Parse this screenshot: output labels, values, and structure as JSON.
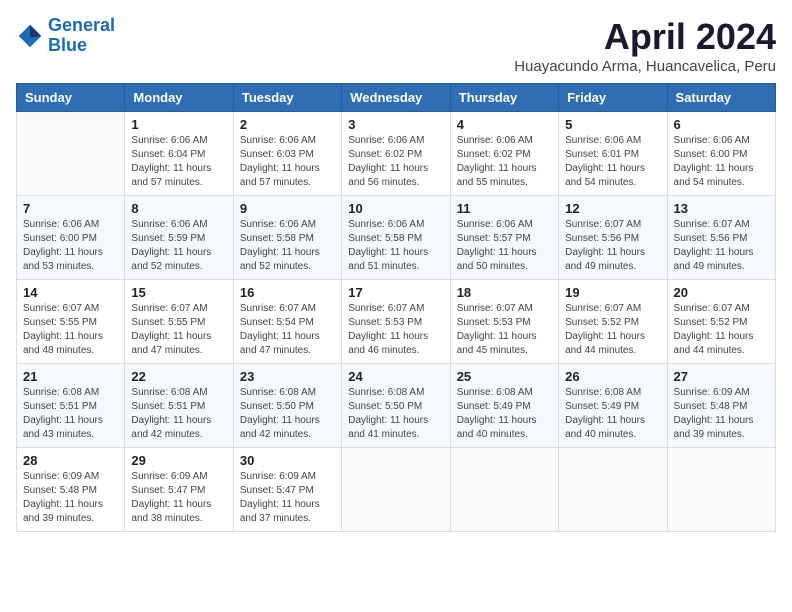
{
  "logo": {
    "line1": "General",
    "line2": "Blue"
  },
  "title": "April 2024",
  "subtitle": "Huayacundo Arma, Huancavelica, Peru",
  "days_of_week": [
    "Sunday",
    "Monday",
    "Tuesday",
    "Wednesday",
    "Thursday",
    "Friday",
    "Saturday"
  ],
  "weeks": [
    [
      {
        "day": "",
        "info": ""
      },
      {
        "day": "1",
        "info": "Sunrise: 6:06 AM\nSunset: 6:04 PM\nDaylight: 11 hours\nand 57 minutes."
      },
      {
        "day": "2",
        "info": "Sunrise: 6:06 AM\nSunset: 6:03 PM\nDaylight: 11 hours\nand 57 minutes."
      },
      {
        "day": "3",
        "info": "Sunrise: 6:06 AM\nSunset: 6:02 PM\nDaylight: 11 hours\nand 56 minutes."
      },
      {
        "day": "4",
        "info": "Sunrise: 6:06 AM\nSunset: 6:02 PM\nDaylight: 11 hours\nand 55 minutes."
      },
      {
        "day": "5",
        "info": "Sunrise: 6:06 AM\nSunset: 6:01 PM\nDaylight: 11 hours\nand 54 minutes."
      },
      {
        "day": "6",
        "info": "Sunrise: 6:06 AM\nSunset: 6:00 PM\nDaylight: 11 hours\nand 54 minutes."
      }
    ],
    [
      {
        "day": "7",
        "info": "Sunrise: 6:06 AM\nSunset: 6:00 PM\nDaylight: 11 hours\nand 53 minutes."
      },
      {
        "day": "8",
        "info": "Sunrise: 6:06 AM\nSunset: 5:59 PM\nDaylight: 11 hours\nand 52 minutes."
      },
      {
        "day": "9",
        "info": "Sunrise: 6:06 AM\nSunset: 5:58 PM\nDaylight: 11 hours\nand 52 minutes."
      },
      {
        "day": "10",
        "info": "Sunrise: 6:06 AM\nSunset: 5:58 PM\nDaylight: 11 hours\nand 51 minutes."
      },
      {
        "day": "11",
        "info": "Sunrise: 6:06 AM\nSunset: 5:57 PM\nDaylight: 11 hours\nand 50 minutes."
      },
      {
        "day": "12",
        "info": "Sunrise: 6:07 AM\nSunset: 5:56 PM\nDaylight: 11 hours\nand 49 minutes."
      },
      {
        "day": "13",
        "info": "Sunrise: 6:07 AM\nSunset: 5:56 PM\nDaylight: 11 hours\nand 49 minutes."
      }
    ],
    [
      {
        "day": "14",
        "info": "Sunrise: 6:07 AM\nSunset: 5:55 PM\nDaylight: 11 hours\nand 48 minutes."
      },
      {
        "day": "15",
        "info": "Sunrise: 6:07 AM\nSunset: 5:55 PM\nDaylight: 11 hours\nand 47 minutes."
      },
      {
        "day": "16",
        "info": "Sunrise: 6:07 AM\nSunset: 5:54 PM\nDaylight: 11 hours\nand 47 minutes."
      },
      {
        "day": "17",
        "info": "Sunrise: 6:07 AM\nSunset: 5:53 PM\nDaylight: 11 hours\nand 46 minutes."
      },
      {
        "day": "18",
        "info": "Sunrise: 6:07 AM\nSunset: 5:53 PM\nDaylight: 11 hours\nand 45 minutes."
      },
      {
        "day": "19",
        "info": "Sunrise: 6:07 AM\nSunset: 5:52 PM\nDaylight: 11 hours\nand 44 minutes."
      },
      {
        "day": "20",
        "info": "Sunrise: 6:07 AM\nSunset: 5:52 PM\nDaylight: 11 hours\nand 44 minutes."
      }
    ],
    [
      {
        "day": "21",
        "info": "Sunrise: 6:08 AM\nSunset: 5:51 PM\nDaylight: 11 hours\nand 43 minutes."
      },
      {
        "day": "22",
        "info": "Sunrise: 6:08 AM\nSunset: 5:51 PM\nDaylight: 11 hours\nand 42 minutes."
      },
      {
        "day": "23",
        "info": "Sunrise: 6:08 AM\nSunset: 5:50 PM\nDaylight: 11 hours\nand 42 minutes."
      },
      {
        "day": "24",
        "info": "Sunrise: 6:08 AM\nSunset: 5:50 PM\nDaylight: 11 hours\nand 41 minutes."
      },
      {
        "day": "25",
        "info": "Sunrise: 6:08 AM\nSunset: 5:49 PM\nDaylight: 11 hours\nand 40 minutes."
      },
      {
        "day": "26",
        "info": "Sunrise: 6:08 AM\nSunset: 5:49 PM\nDaylight: 11 hours\nand 40 minutes."
      },
      {
        "day": "27",
        "info": "Sunrise: 6:09 AM\nSunset: 5:48 PM\nDaylight: 11 hours\nand 39 minutes."
      }
    ],
    [
      {
        "day": "28",
        "info": "Sunrise: 6:09 AM\nSunset: 5:48 PM\nDaylight: 11 hours\nand 39 minutes."
      },
      {
        "day": "29",
        "info": "Sunrise: 6:09 AM\nSunset: 5:47 PM\nDaylight: 11 hours\nand 38 minutes."
      },
      {
        "day": "30",
        "info": "Sunrise: 6:09 AM\nSunset: 5:47 PM\nDaylight: 11 hours\nand 37 minutes."
      },
      {
        "day": "",
        "info": ""
      },
      {
        "day": "",
        "info": ""
      },
      {
        "day": "",
        "info": ""
      },
      {
        "day": "",
        "info": ""
      }
    ]
  ]
}
